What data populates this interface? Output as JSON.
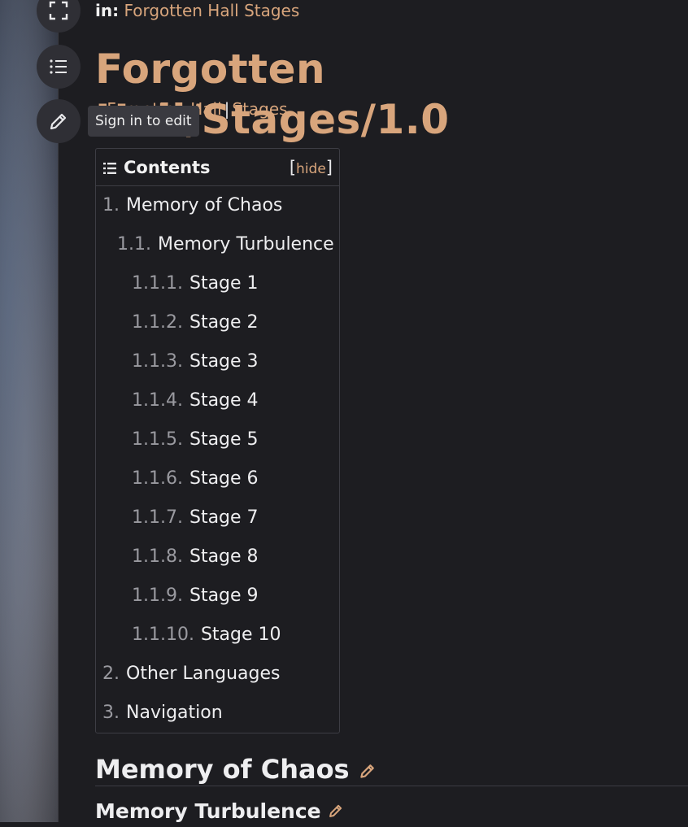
{
  "header": {
    "in_label": "in:",
    "in_link": "Forgotten Hall Stages",
    "title": "Forgotten Hall/Stages/1.0",
    "subcrumb_first": "Forgotten Hall",
    "subcrumb_sep": "|",
    "subcrumb_second": "Stages"
  },
  "rail": {
    "tooltip": "Sign in to edit"
  },
  "toc": {
    "title": "Contents",
    "hide_label": "hide",
    "items": [
      {
        "num": "1.",
        "label": "Memory of Chaos"
      },
      {
        "num": "1.1.",
        "label": "Memory Turbulence"
      },
      {
        "num": "1.1.1.",
        "label": "Stage 1"
      },
      {
        "num": "1.1.2.",
        "label": "Stage 2"
      },
      {
        "num": "1.1.3.",
        "label": "Stage 3"
      },
      {
        "num": "1.1.4.",
        "label": "Stage 4"
      },
      {
        "num": "1.1.5.",
        "label": "Stage 5"
      },
      {
        "num": "1.1.6.",
        "label": "Stage 6"
      },
      {
        "num": "1.1.7.",
        "label": "Stage 7"
      },
      {
        "num": "1.1.8.",
        "label": "Stage 8"
      },
      {
        "num": "1.1.9.",
        "label": "Stage 9"
      },
      {
        "num": "1.1.10.",
        "label": "Stage 10"
      },
      {
        "num": "2.",
        "label": "Other Languages"
      },
      {
        "num": "3.",
        "label": "Navigation"
      }
    ]
  },
  "content": {
    "h2": "Memory of Chaos",
    "h3": "Memory Turbulence"
  },
  "colors": {
    "accent": "#d8a57c",
    "background": "#1d1d21"
  }
}
